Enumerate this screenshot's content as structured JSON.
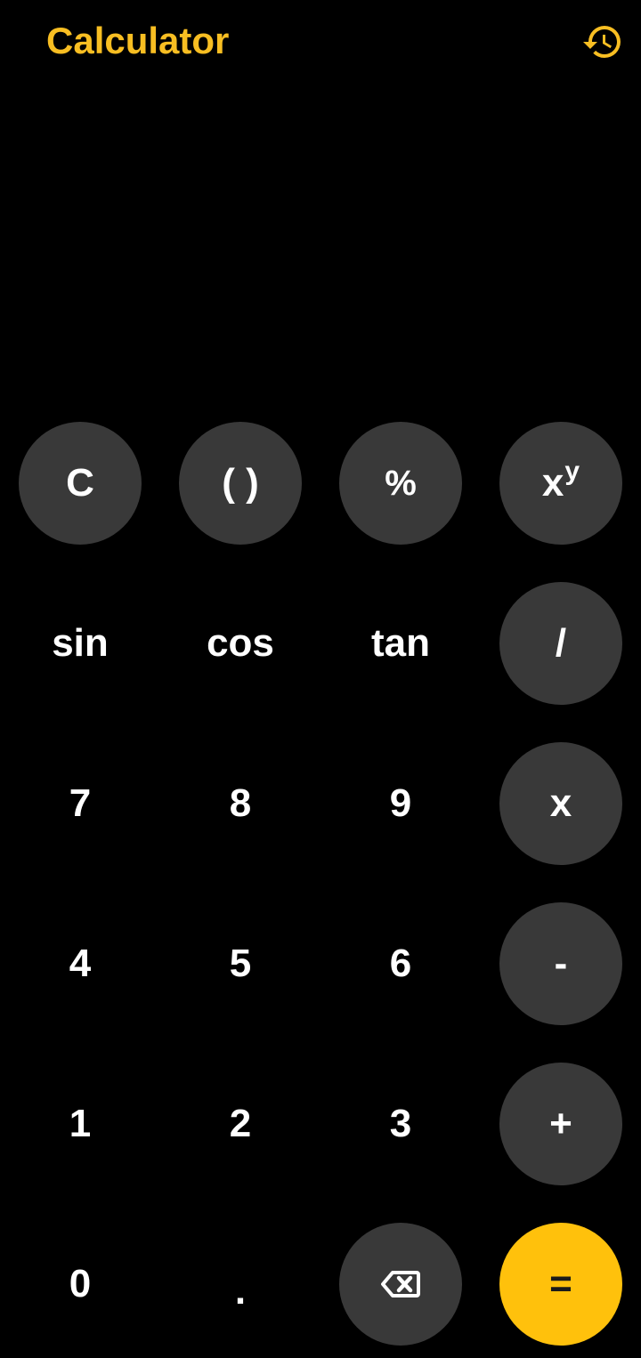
{
  "app": {
    "title": "Calculator"
  },
  "header": {
    "history_icon": "history-icon"
  },
  "display": {
    "expression": "",
    "result": ""
  },
  "colors": {
    "accent": "#F8BE22",
    "equals_bg": "#FFC10C",
    "key_bg": "#393939",
    "background": "#000000"
  },
  "keys": {
    "clear": "C",
    "parentheses": "( )",
    "percent": "%",
    "power_base": "x",
    "power_exp": "y",
    "sin": "sin",
    "cos": "cos",
    "tan": "tan",
    "divide": "/",
    "seven": "7",
    "eight": "8",
    "nine": "9",
    "multiply": "x",
    "four": "4",
    "five": "5",
    "six": "6",
    "minus": "-",
    "one": "1",
    "two": "2",
    "three": "3",
    "plus": "+",
    "zero": "0",
    "decimal": ".",
    "backspace_icon": "backspace-icon",
    "equals": "="
  }
}
